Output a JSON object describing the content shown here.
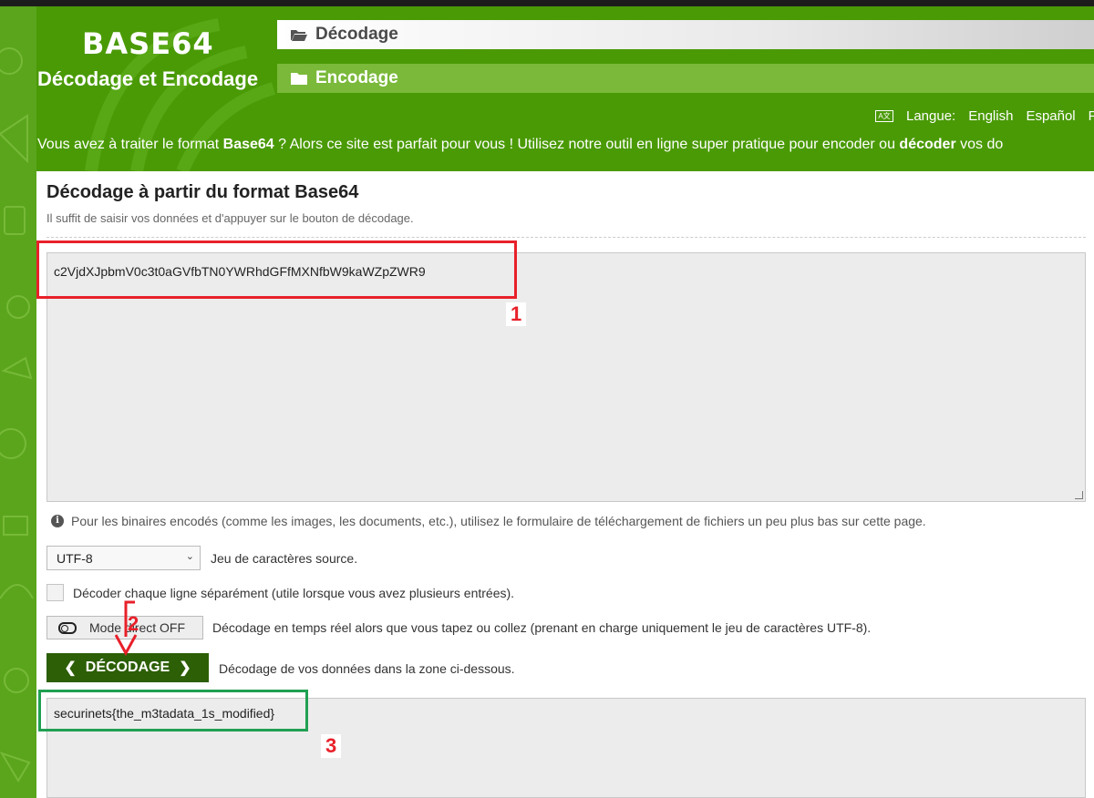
{
  "header": {
    "logo": "BASE64",
    "tagline": "Décodage et Encodage",
    "nav_decode": "Décodage",
    "nav_encode": "Encodage",
    "lang_label": "Langue:",
    "languages": [
      "English",
      "Español",
      "F"
    ],
    "intro_1": "Vous avez à traiter le format ",
    "intro_bold_1": "Base64",
    "intro_2": " ? Alors ce site est parfait pour vous ! Utilisez notre outil en ligne super pratique pour encoder ou ",
    "intro_bold_2": "décoder",
    "intro_3": " vos do"
  },
  "main": {
    "title": "Décodage à partir du format Base64",
    "subtitle": "Il suffit de saisir vos données et d'appuyer sur le bouton de décodage.",
    "input_value": "c2VjdXJpbmV0c3t0aGVfbTN0YWRhdGFfMXNfbW9kaWZpZWR9",
    "info_text": "Pour les binaires encodés (comme les images, les documents, etc.), utilisez le formulaire de téléchargement de fichiers un peu plus bas sur cette page.",
    "charset_value": "UTF-8",
    "charset_label": "Jeu de caractères source.",
    "separate_lines_label": "Décoder chaque ligne séparément (utile lorsque vous avez plusieurs entrées).",
    "live_mode_label": "Mode direct OFF",
    "live_mode_desc": "Décodage en temps réel alors que vous tapez ou collez (prenant en charge uniquement le jeu de caractères UTF-8).",
    "decode_button": "DÉCODAGE",
    "decode_desc": "Décodage de vos données dans la zone ci-dessous.",
    "output_value": "securinets{the_m3tadata_1s_modified}"
  },
  "annotations": {
    "step1": "1",
    "step2": "2",
    "step3": "3",
    "colors": {
      "input_box": "#e8202a",
      "output_box": "#20a052",
      "arrow": "#e8202a"
    }
  }
}
